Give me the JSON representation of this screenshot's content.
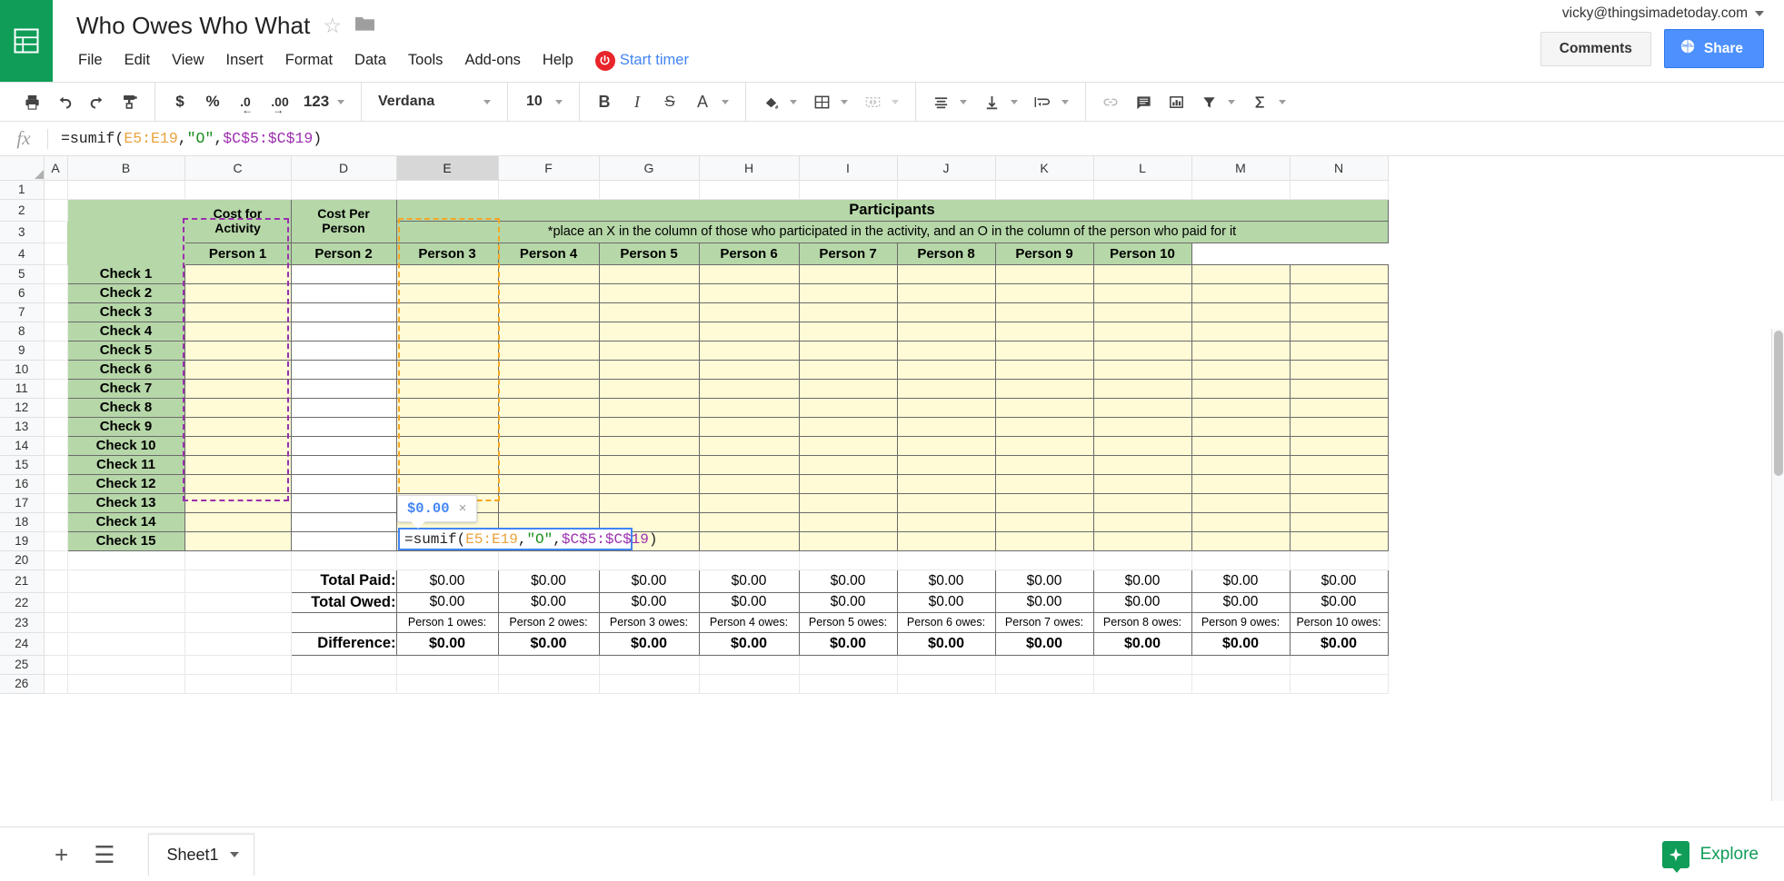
{
  "header": {
    "doc_title": "Who Owes Who What",
    "star_icon": "star-outline-icon",
    "folder_icon": "folder-icon",
    "menus": [
      "File",
      "Edit",
      "View",
      "Insert",
      "Format",
      "Data",
      "Tools",
      "Add-ons",
      "Help"
    ],
    "timer_label": "Start timer",
    "account_email": "vicky@thingsimadetoday.com",
    "comments_label": "Comments",
    "share_label": "Share",
    "brand_green": "#0f9d58",
    "accent_blue": "#4285f4",
    "share_blue": "#4d90fe",
    "timer_red": "#e8242a"
  },
  "toolbar": {
    "print": "print-icon",
    "undo": "undo-icon",
    "redo": "redo-icon",
    "paint_format": "paint-format-icon",
    "currency": "$",
    "percent": "%",
    "decrease_decimal": ".0",
    "increase_decimal": ".00",
    "more_formats": "123",
    "font_name": "Verdana",
    "font_size": "10",
    "bold": "B",
    "italic": "I",
    "strikethrough": "S",
    "text_color": "A",
    "fill_color": "fill-color-icon",
    "borders": "borders-icon",
    "merge_cells": "merge-cells-icon",
    "horizontal_align": "align-left-icon",
    "vertical_align": "vertical-align-icon",
    "text_wrap": "text-wrap-icon",
    "insert_link": "link-icon",
    "insert_comment": "comment-icon",
    "insert_chart": "chart-icon",
    "filter": "filter-icon",
    "functions": "sigma-icon"
  },
  "formula_bar": {
    "fx": "fx",
    "formula_full": "=sumif(E5:E19,\"O\",$C$5:$C$19)",
    "tokens": {
      "t1": "=sumif(",
      "t2": "E5:E19",
      "t3": ",",
      "t4": "\"O\"",
      "t5": ",",
      "t6": "$C$5:$C$19",
      "t7": ")"
    }
  },
  "grid": {
    "columns": [
      "A",
      "B",
      "C",
      "D",
      "E",
      "F",
      "G",
      "H",
      "I",
      "J",
      "K",
      "L",
      "M",
      "N"
    ],
    "selected_column": "E",
    "rows": [
      1,
      2,
      3,
      4,
      5,
      6,
      7,
      8,
      9,
      10,
      11,
      12,
      13,
      14,
      15,
      16,
      17,
      18,
      19,
      20,
      21,
      22,
      23,
      24,
      25,
      26
    ]
  },
  "sheet": {
    "participants_title": "Participants",
    "participants_note": "*place an X in the column of those who participated in the activity, and an O in the column of the person who paid for it",
    "col_cost_activity": "Cost for\nActivity",
    "col_cost_activity_l1": "Cost for",
    "col_cost_activity_l2": "Activity",
    "col_cost_person_l1": "Cost Per",
    "col_cost_person_l2": "Person",
    "person_headers": [
      "Person 1",
      "Person 2",
      "Person 3",
      "Person 4",
      "Person 5",
      "Person 6",
      "Person 7",
      "Person 8",
      "Person 9",
      "Person 10"
    ],
    "check_labels": [
      "Check 1",
      "Check 2",
      "Check 3",
      "Check 4",
      "Check 5",
      "Check 6",
      "Check 7",
      "Check 8",
      "Check 9",
      "Check 10",
      "Check 11",
      "Check 12",
      "Check 13",
      "Check 14",
      "Check 15"
    ],
    "total_paid_label": "Total Paid:",
    "total_owed_label": "Total Owed:",
    "difference_label": "Difference:",
    "total_paid_values": [
      "$0.00",
      "$0.00",
      "$0.00",
      "$0.00",
      "$0.00",
      "$0.00",
      "$0.00",
      "$0.00",
      "$0.00",
      "$0.00"
    ],
    "total_owed_values": [
      "$0.00",
      "$0.00",
      "$0.00",
      "$0.00",
      "$0.00",
      "$0.00",
      "$0.00",
      "$0.00",
      "$0.00",
      "$0.00"
    ],
    "owes_notes": [
      "Person 1 owes:",
      "Person 2 owes:",
      "Person 3 owes:",
      "Person 4 owes:",
      "Person 5 owes:",
      "Person 6 owes:",
      "Person 7 owes:",
      "Person 8 owes:",
      "Person 9 owes:",
      "Person 10 owes:"
    ],
    "difference_values": [
      "$0.00",
      "$0.00",
      "$0.00",
      "$0.00",
      "$0.00",
      "$0.00",
      "$0.00",
      "$0.00",
      "$0.00",
      "$0.00"
    ],
    "header_green": "#b6d7a8",
    "input_yellow": "#fffbd6",
    "range_purple": "#9b2fae",
    "range_orange": "#f5a623"
  },
  "active_cell": {
    "address": "E21",
    "editing_text": "=sumif(E5:E19,\"O\",$C$5:$C$19)",
    "tokens": {
      "t1": "=sumif(",
      "t2": "E5:E19",
      "t3": ",",
      "t4": "\"O\"",
      "t5": ",",
      "t6": "$C$5:$C$19",
      "t7": ")"
    },
    "tooltip_value": "$0.00",
    "tooltip_close": "×"
  },
  "bottom": {
    "add_sheet_icon": "plus-icon",
    "all_sheets_icon": "list-icon",
    "sheet_name": "Sheet1",
    "sheet_menu_icon": "chevron-down-icon",
    "explore_label": "Explore",
    "explore_icon": "explore-star-icon"
  }
}
